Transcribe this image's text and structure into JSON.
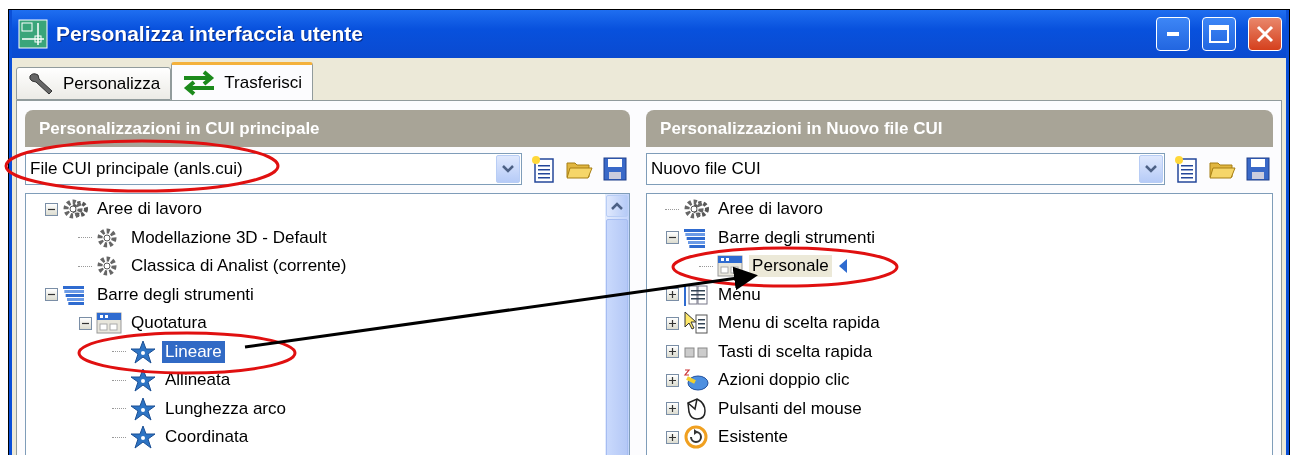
{
  "window": {
    "title": "Personalizza interfaccia utente"
  },
  "tabs": [
    {
      "label": "Personalizza",
      "kind": "wrench",
      "selected": false
    },
    {
      "label": "Trasferisci",
      "kind": "arrows",
      "selected": true
    }
  ],
  "panels": [
    {
      "title": "Personalizzazioni in CUI principale",
      "file": "File CUI principale (anls.cui)",
      "active": true,
      "scrollbar": true,
      "tree": [
        {
          "label": "Aree di lavoro",
          "kind": "gears",
          "selected": false,
          "expanded": true,
          "children": [
            {
              "label": "Modellazione 3D - Default",
              "kind": "gear",
              "selected": false
            },
            {
              "label": "Classica di Analist (corrente)",
              "kind": "gear",
              "selected": false
            }
          ]
        },
        {
          "label": "Barre degli strumenti",
          "kind": "toolbars",
          "selected": false,
          "expanded": true,
          "children": [
            {
              "label": "Quotatura",
              "kind": "toolbar",
              "selected": false,
              "expanded": true,
              "children": [
                {
                  "label": "Lineare",
                  "kind": "star",
                  "selected": true
                },
                {
                  "label": "Allineata",
                  "kind": "star",
                  "selected": false
                },
                {
                  "label": "Lunghezza arco",
                  "kind": "star",
                  "selected": false
                },
                {
                  "label": "Coordinata",
                  "kind": "star",
                  "selected": false
                }
              ]
            }
          ]
        }
      ]
    },
    {
      "title": "Personalizzazioni in Nuovo file CUI",
      "file": "Nuovo file CUI",
      "active": false,
      "scrollbar": false,
      "tree": [
        {
          "label": "Aree di lavoro",
          "kind": "gears",
          "selected": false
        },
        {
          "label": "Barre degli strumenti",
          "kind": "toolbars",
          "selected": false,
          "expanded": true,
          "children": [
            {
              "label": "Personale",
              "kind": "toolbar",
              "selected": true,
              "marked": true
            }
          ]
        },
        {
          "label": "Menu",
          "kind": "menu",
          "selected": false,
          "expanded": false
        },
        {
          "label": "Menu di scelta rapida",
          "kind": "shortcut-menu",
          "selected": false,
          "expanded": false
        },
        {
          "label": "Tasti di scelta rapida",
          "kind": "keys",
          "selected": false,
          "expanded": false
        },
        {
          "label": "Azioni doppio clic",
          "kind": "double-click",
          "selected": false,
          "expanded": false
        },
        {
          "label": "Pulsanti del mouse",
          "kind": "mouse",
          "selected": false,
          "expanded": false
        },
        {
          "label": "Esistente",
          "kind": "legacy",
          "selected": false,
          "expanded": false
        }
      ]
    }
  ]
}
